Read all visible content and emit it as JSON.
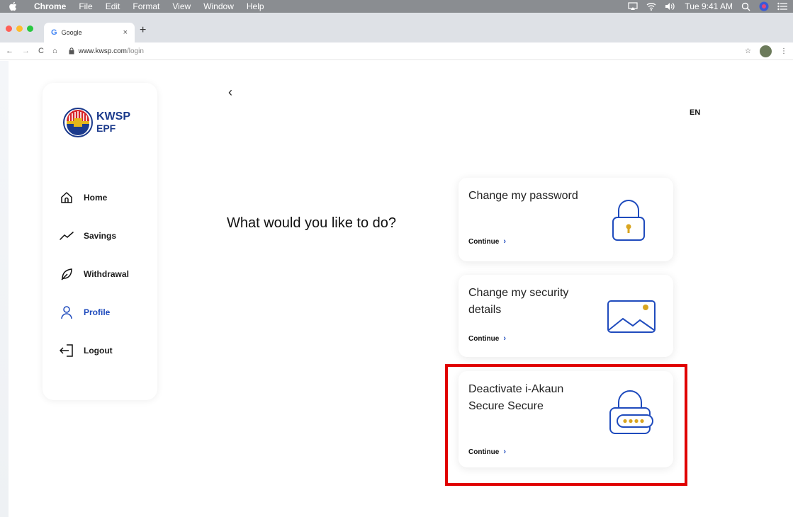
{
  "menubar": {
    "app": "Chrome",
    "items": [
      "File",
      "Edit",
      "Format",
      "View",
      "Window",
      "Help"
    ],
    "clock": "Tue 9:41 AM"
  },
  "browser": {
    "tab_title": "Google",
    "tab_g": "G",
    "url_host": "www.kwsp.com",
    "url_path": "/login"
  },
  "sidebar": {
    "logo_line1": "KWSP",
    "logo_line2": "EPF",
    "items": [
      {
        "label": "Home",
        "icon": "home-icon",
        "active": false
      },
      {
        "label": "Savings",
        "icon": "trend-icon",
        "active": false
      },
      {
        "label": "Withdrawal",
        "icon": "leaf-icon",
        "active": false
      },
      {
        "label": "Profile",
        "icon": "profile-icon",
        "active": true
      },
      {
        "label": "Logout",
        "icon": "logout-icon",
        "active": false
      }
    ]
  },
  "main": {
    "back_glyph": "‹",
    "language": "EN",
    "question": "What would you like to do?",
    "cards": [
      {
        "title": "Change my password",
        "cta": "Continue",
        "icon": "padlock-icon"
      },
      {
        "title": "Change my security details",
        "cta": "Continue",
        "icon": "image-icon"
      },
      {
        "title": "Deactivate i-Akaun Secure Secure",
        "cta": "Continue",
        "icon": "secure-lock-icon"
      }
    ]
  },
  "colors": {
    "brand_blue": "#1f4bbd",
    "accent_gold": "#d9a520",
    "highlight_red": "#e00000"
  }
}
